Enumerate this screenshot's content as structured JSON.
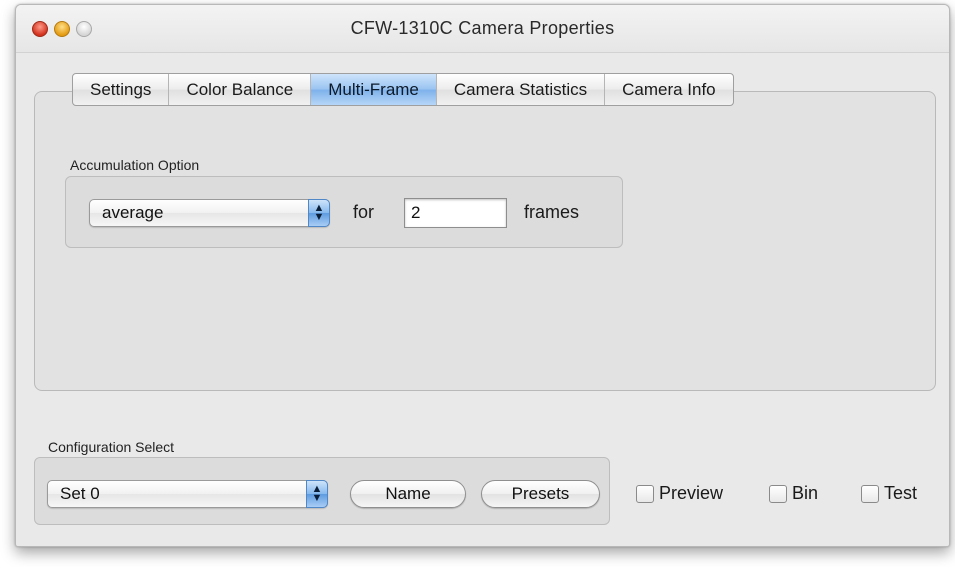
{
  "window": {
    "title": "CFW-1310C Camera Properties"
  },
  "tabs": [
    {
      "label": "Settings",
      "active": false
    },
    {
      "label": "Color Balance",
      "active": false
    },
    {
      "label": "Multi-Frame",
      "active": true
    },
    {
      "label": "Camera Statistics",
      "active": false
    },
    {
      "label": "Camera Info",
      "active": false
    }
  ],
  "accumulation": {
    "group_label": "Accumulation Option",
    "mode_value": "average",
    "for_label": "for",
    "frames_value": "2",
    "frames_label": "frames"
  },
  "configuration": {
    "group_label": "Configuration Select",
    "set_value": "Set 0",
    "name_button": "Name",
    "presets_button": "Presets"
  },
  "checkboxes": [
    {
      "label": "Preview",
      "checked": false
    },
    {
      "label": "Bin",
      "checked": false
    },
    {
      "label": "Test",
      "checked": false
    }
  ],
  "icons": {
    "popup_arrows": "up-down-chevron-icon",
    "close": "close-button-icon",
    "minimize": "minimize-button-icon",
    "zoom": "zoom-button-icon"
  },
  "colors": {
    "accent_blue": "#86b8ee",
    "close_red": "#d2321d",
    "minimize_yellow": "#e49b12"
  }
}
